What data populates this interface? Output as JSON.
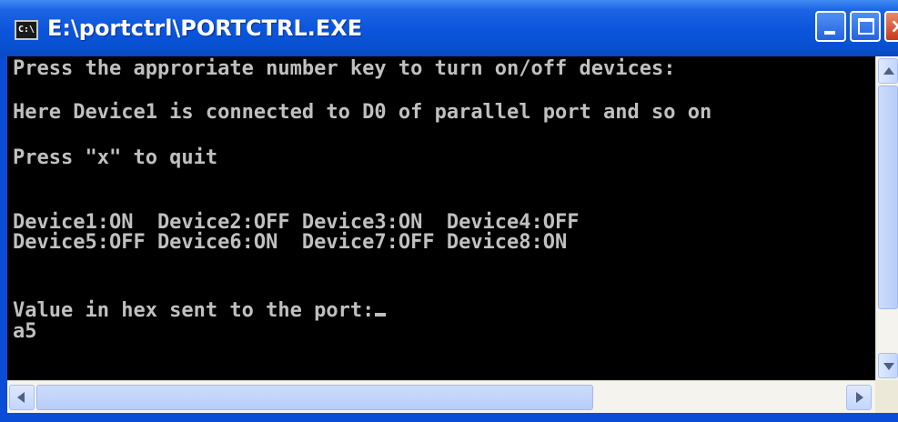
{
  "window": {
    "title": "E:\\portctrl\\PORTCTRL.EXE",
    "icon": "console-icon",
    "icon_text": "C:\\"
  },
  "titlebar_buttons": {
    "minimize": "minimize-icon",
    "maximize": "maximize-icon",
    "close": "close-icon",
    "close_glyph": "×"
  },
  "console": {
    "lines": [
      "Press the approriate number key to turn on/off devices:",
      "Here Device1 is connected to D0 of parallel port and so on",
      "Press \"x\" to quit",
      "Device1:ON  Device2:OFF Device3:ON  Device4:OFF",
      "Device5:OFF Device6:ON  Device7:OFF Device8:ON",
      "Value in hex sent to the port:",
      "a5"
    ]
  },
  "scrollbars": {
    "vertical": {
      "up": "scroll-up-arrow-icon",
      "down": "scroll-down-arrow-icon"
    },
    "horizontal": {
      "left": "scroll-left-arrow-icon",
      "right": "scroll-right-arrow-icon"
    }
  },
  "colors": {
    "titlebar": "#0a55dc",
    "console_bg": "#000000",
    "console_text": "#c0c0c0"
  }
}
